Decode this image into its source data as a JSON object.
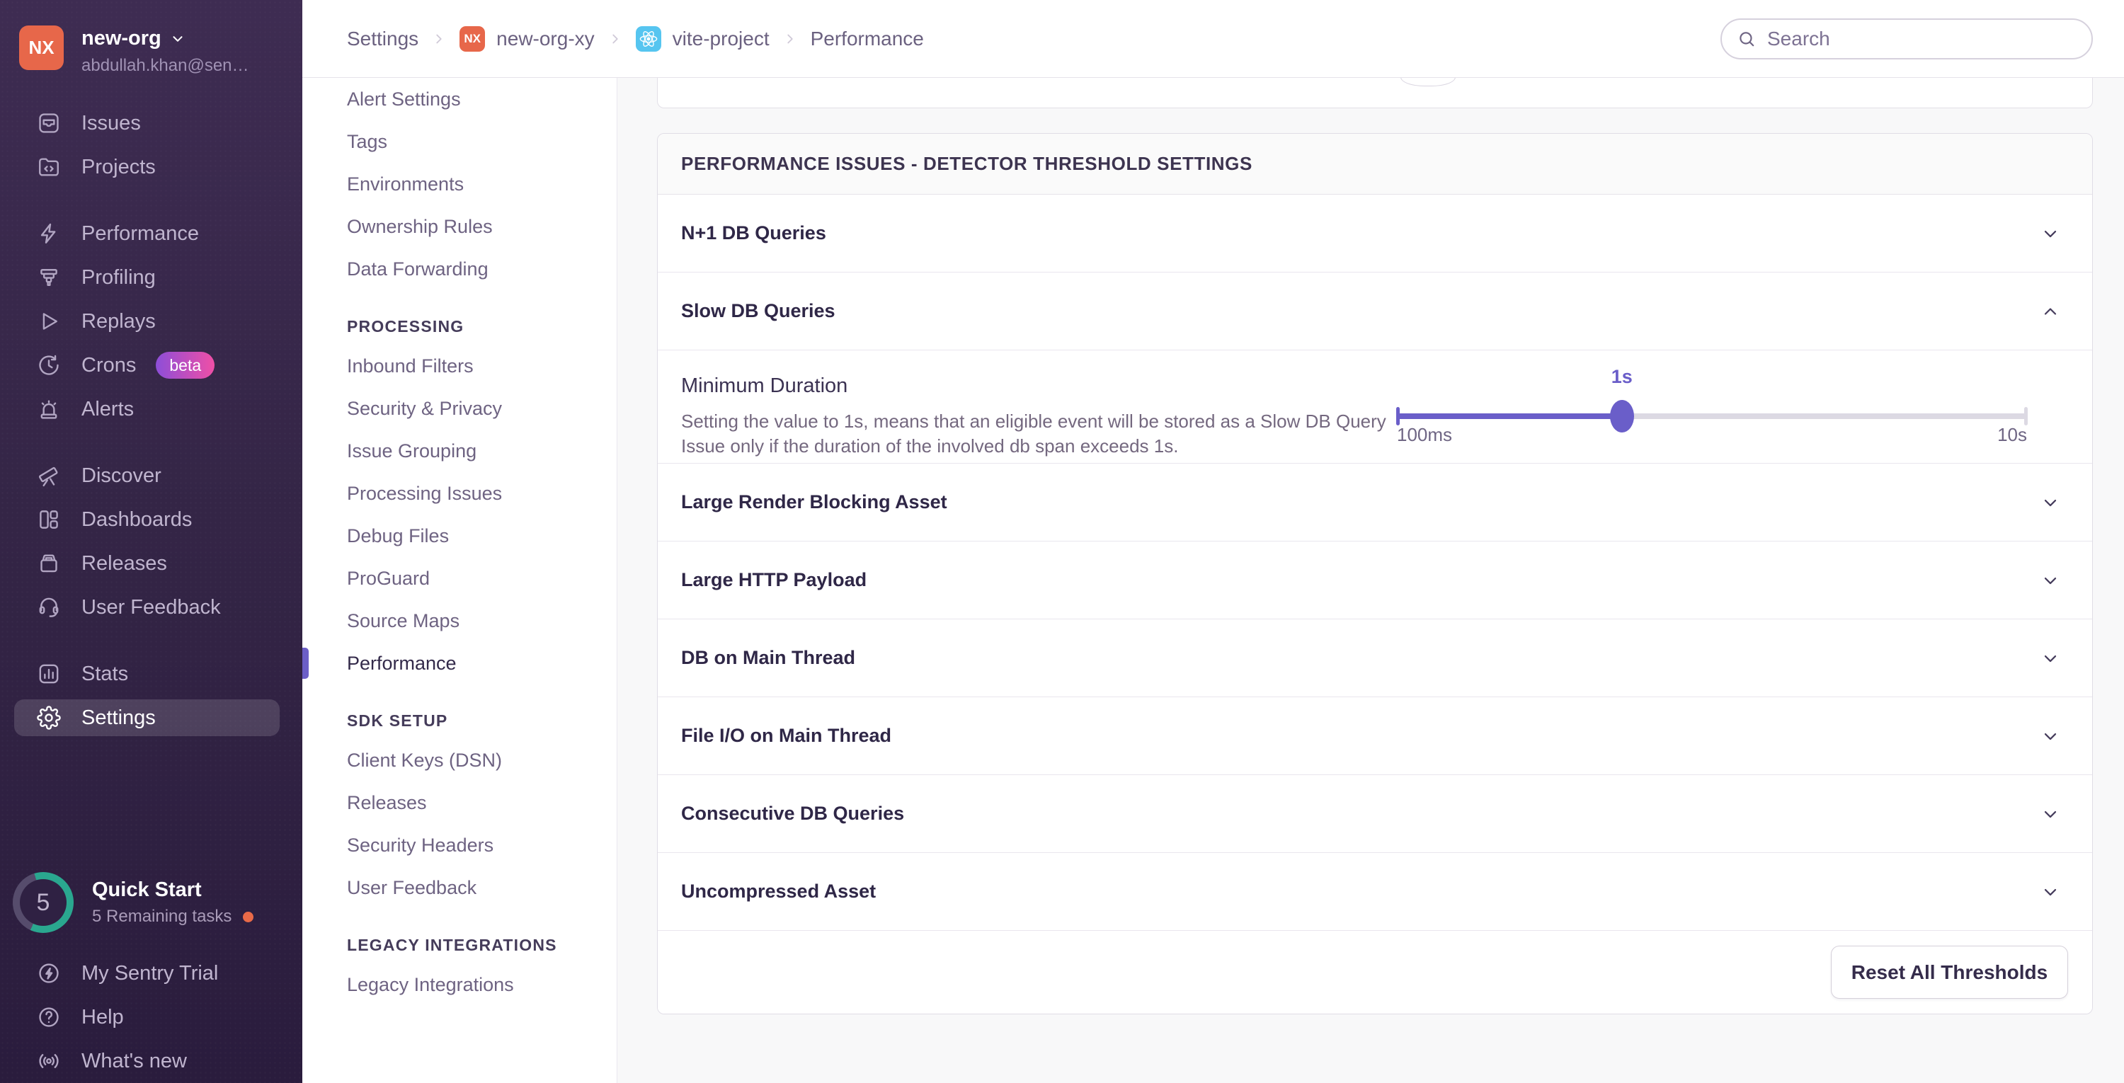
{
  "colors": {
    "accent_purple": "#6c5fc7",
    "sidebar_top": "#3e2c52",
    "sidebar_bottom": "#2a1c3d",
    "org_avatar": "#e7674a",
    "react_badge": "#56c5f0",
    "quickstart_green": "#2aa78f",
    "alert_dot": "#e96a48",
    "beta_gradient_start": "#8d4ed8",
    "beta_gradient_end": "#ef4fa6"
  },
  "primary_sidebar": {
    "org": {
      "initials": "NX",
      "name": "new-org",
      "email": "abdullah.khan@sen…"
    },
    "sections": [
      {
        "items": [
          {
            "icon": "issues-icon",
            "label": "Issues"
          },
          {
            "icon": "projects-icon",
            "label": "Projects"
          }
        ]
      },
      {
        "items": [
          {
            "icon": "performance-icon",
            "label": "Performance"
          },
          {
            "icon": "profiling-icon",
            "label": "Profiling"
          },
          {
            "icon": "replays-icon",
            "label": "Replays"
          },
          {
            "icon": "crons-icon",
            "label": "Crons",
            "badge": "beta"
          },
          {
            "icon": "alerts-icon",
            "label": "Alerts"
          }
        ]
      },
      {
        "items": [
          {
            "icon": "discover-icon",
            "label": "Discover"
          },
          {
            "icon": "dashboards-icon",
            "label": "Dashboards"
          },
          {
            "icon": "releases-icon",
            "label": "Releases"
          },
          {
            "icon": "user-feedback-icon",
            "label": "User Feedback"
          }
        ]
      },
      {
        "items": [
          {
            "icon": "stats-icon",
            "label": "Stats"
          },
          {
            "icon": "settings-icon",
            "label": "Settings",
            "active": true
          }
        ]
      }
    ],
    "quick_start": {
      "count": "5",
      "title": "Quick Start",
      "subtitle": "5 Remaining tasks"
    },
    "footer_items": [
      {
        "icon": "trial-icon",
        "label": "My Sentry Trial"
      },
      {
        "icon": "help-icon",
        "label": "Help"
      },
      {
        "icon": "whats-new-icon",
        "label": "What's new"
      }
    ]
  },
  "topbar": {
    "breadcrumb": [
      {
        "label": "Settings"
      },
      {
        "label": "new-org-xy",
        "badge": "nx",
        "badge_text": "NX"
      },
      {
        "label": "vite-project",
        "badge": "react"
      },
      {
        "label": "Performance",
        "last": true
      }
    ],
    "search_placeholder": "Search"
  },
  "settings_nav": {
    "active_item": "Performance",
    "groups": [
      {
        "items": [
          "Alert Settings",
          "Tags",
          "Environments",
          "Ownership Rules",
          "Data Forwarding"
        ]
      },
      {
        "header": "PROCESSING",
        "items": [
          "Inbound Filters",
          "Security & Privacy",
          "Issue Grouping",
          "Processing Issues",
          "Debug Files",
          "ProGuard",
          "Source Maps",
          "Performance"
        ]
      },
      {
        "header": "SDK SETUP",
        "items": [
          "Client Keys (DSN)",
          "Releases",
          "Security Headers",
          "User Feedback"
        ]
      },
      {
        "header": "LEGACY INTEGRATIONS",
        "items": [
          "Legacy Integrations"
        ]
      }
    ]
  },
  "panel": {
    "title": "PERFORMANCE ISSUES - DETECTOR THRESHOLD SETTINGS",
    "rows": [
      {
        "label": "N+1 DB Queries",
        "state": "collapsed"
      },
      {
        "label": "Slow DB Queries",
        "state": "expanded"
      },
      {
        "label": "Large Render Blocking Asset",
        "state": "collapsed"
      },
      {
        "label": "Large HTTP Payload",
        "state": "collapsed"
      },
      {
        "label": "DB on Main Thread",
        "state": "collapsed"
      },
      {
        "label": "File I/O on Main Thread",
        "state": "collapsed"
      },
      {
        "label": "Consecutive DB Queries",
        "state": "collapsed"
      },
      {
        "label": "Uncompressed Asset",
        "state": "collapsed"
      }
    ],
    "slow_db_detail": {
      "label": "Minimum Duration",
      "description": "Setting the value to 1s, means that an eligible event will be stored as a Slow DB Query Issue only if the duration of the involved db span exceeds 1s.",
      "slider": {
        "value_label": "1s",
        "min_label": "100ms",
        "max_label": "10s",
        "percent": 35.7
      }
    },
    "footer": {
      "reset_label": "Reset All Thresholds"
    }
  }
}
